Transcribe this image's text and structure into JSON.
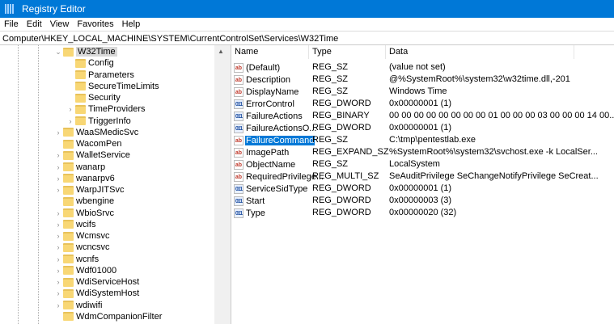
{
  "window": {
    "title": "Registry Editor"
  },
  "menu": [
    "File",
    "Edit",
    "View",
    "Favorites",
    "Help"
  ],
  "address": "Computer\\HKEY_LOCAL_MACHINE\\SYSTEM\\CurrentControlSet\\Services\\W32Time",
  "tree": [
    {
      "label": "W32Time",
      "level": 0,
      "expander": "expanded",
      "selected": true
    },
    {
      "label": "Config",
      "level": 1,
      "expander": "none"
    },
    {
      "label": "Parameters",
      "level": 1,
      "expander": "none"
    },
    {
      "label": "SecureTimeLimits",
      "level": 1,
      "expander": "none"
    },
    {
      "label": "Security",
      "level": 1,
      "expander": "none"
    },
    {
      "label": "TimeProviders",
      "level": 1,
      "expander": "collapsed"
    },
    {
      "label": "TriggerInfo",
      "level": 1,
      "expander": "collapsed"
    },
    {
      "label": "WaaSMedicSvc",
      "level": 0,
      "expander": "collapsed"
    },
    {
      "label": "WacomPen",
      "level": 0,
      "expander": "none"
    },
    {
      "label": "WalletService",
      "level": 0,
      "expander": "collapsed"
    },
    {
      "label": "wanarp",
      "level": 0,
      "expander": "collapsed"
    },
    {
      "label": "wanarpv6",
      "level": 0,
      "expander": "collapsed"
    },
    {
      "label": "WarpJITSvc",
      "level": 0,
      "expander": "collapsed"
    },
    {
      "label": "wbengine",
      "level": 0,
      "expander": "none"
    },
    {
      "label": "WbioSrvc",
      "level": 0,
      "expander": "collapsed"
    },
    {
      "label": "wcifs",
      "level": 0,
      "expander": "collapsed"
    },
    {
      "label": "Wcmsvc",
      "level": 0,
      "expander": "collapsed"
    },
    {
      "label": "wcncsvc",
      "level": 0,
      "expander": "collapsed"
    },
    {
      "label": "wcnfs",
      "level": 0,
      "expander": "collapsed"
    },
    {
      "label": "Wdf01000",
      "level": 0,
      "expander": "collapsed"
    },
    {
      "label": "WdiServiceHost",
      "level": 0,
      "expander": "collapsed"
    },
    {
      "label": "WdiSystemHost",
      "level": 0,
      "expander": "collapsed"
    },
    {
      "label": "wdiwifi",
      "level": 0,
      "expander": "collapsed"
    },
    {
      "label": "WdmCompanionFilter",
      "level": 0,
      "expander": "none"
    }
  ],
  "columns": {
    "name": "Name",
    "type": "Type",
    "data": "Data"
  },
  "values": [
    {
      "name": "(Default)",
      "type": "REG_SZ",
      "data": "(value not set)",
      "icon": "string"
    },
    {
      "name": "Description",
      "type": "REG_SZ",
      "data": "@%SystemRoot%\\system32\\w32time.dll,-201",
      "icon": "string"
    },
    {
      "name": "DisplayName",
      "type": "REG_SZ",
      "data": "Windows Time",
      "icon": "string"
    },
    {
      "name": "ErrorControl",
      "type": "REG_DWORD",
      "data": "0x00000001 (1)",
      "icon": "binary"
    },
    {
      "name": "FailureActions",
      "type": "REG_BINARY",
      "data": "00 00 00 00 00 00 00 00 01 00 00 00 03 00 00 00 14 00...",
      "icon": "binary"
    },
    {
      "name": "FailureActionsO...",
      "type": "REG_DWORD",
      "data": "0x00000001 (1)",
      "icon": "binary"
    },
    {
      "name": "FailureCommand",
      "type": "REG_SZ",
      "data": "C:\\tmp\\pentestlab.exe",
      "icon": "string",
      "selected": true
    },
    {
      "name": "ImagePath",
      "type": "REG_EXPAND_SZ",
      "data": "%SystemRoot%\\system32\\svchost.exe -k LocalSer...",
      "icon": "string"
    },
    {
      "name": "ObjectName",
      "type": "REG_SZ",
      "data": "LocalSystem",
      "icon": "string"
    },
    {
      "name": "RequiredPrivilege...",
      "type": "REG_MULTI_SZ",
      "data": "SeAuditPrivilege SeChangeNotifyPrivilege SeCreat...",
      "icon": "string"
    },
    {
      "name": "ServiceSidType",
      "type": "REG_DWORD",
      "data": "0x00000001 (1)",
      "icon": "binary"
    },
    {
      "name": "Start",
      "type": "REG_DWORD",
      "data": "0x00000003 (3)",
      "icon": "binary"
    },
    {
      "name": "Type",
      "type": "REG_DWORD",
      "data": "0x00000020 (32)",
      "icon": "binary"
    }
  ],
  "colors": {
    "titlebar": "#0078d7",
    "selection": "#0078d7",
    "folder": "#f8d775"
  }
}
